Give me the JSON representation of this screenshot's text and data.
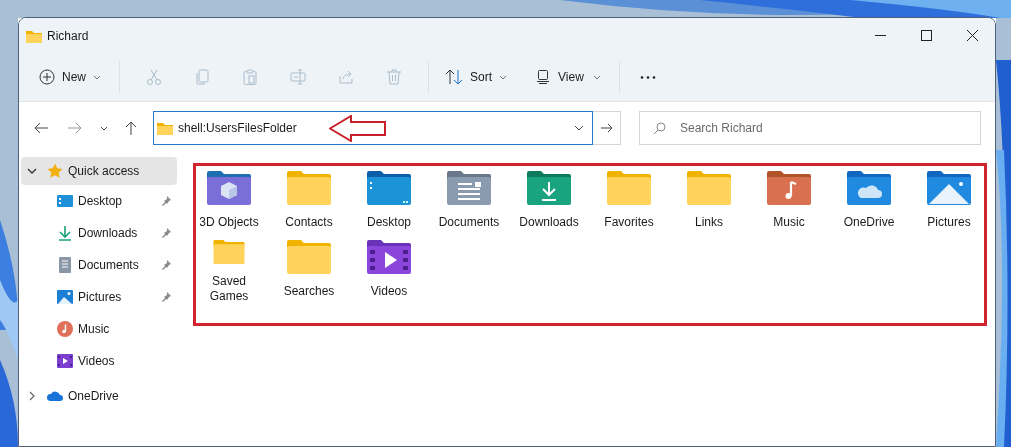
{
  "window": {
    "title": "Richard"
  },
  "toolbar": {
    "new": {
      "label": "New"
    },
    "actions": [
      {
        "kind": "cut",
        "disabled": true
      },
      {
        "kind": "copy",
        "disabled": true
      },
      {
        "kind": "paste",
        "disabled": true
      },
      {
        "kind": "rename",
        "disabled": true
      },
      {
        "kind": "share",
        "disabled": true
      },
      {
        "kind": "delete",
        "disabled": true
      }
    ],
    "sort": {
      "label": "Sort"
    },
    "view": {
      "label": "View"
    }
  },
  "address": {
    "value": "shell:UsersFilesFolder"
  },
  "search": {
    "placeholder": "Search Richard"
  },
  "sidebar": {
    "items": [
      {
        "label": "Quick access",
        "kind": "star",
        "selected": true,
        "expanded": true,
        "children": [
          {
            "label": "Desktop",
            "kind": "desktop",
            "pinned": true
          },
          {
            "label": "Downloads",
            "kind": "downloads",
            "pinned": true
          },
          {
            "label": "Documents",
            "kind": "documents",
            "pinned": true
          },
          {
            "label": "Pictures",
            "kind": "pictures",
            "pinned": true
          },
          {
            "label": "Music",
            "kind": "music",
            "pinned": false
          },
          {
            "label": "Videos",
            "kind": "videos",
            "pinned": false
          }
        ]
      },
      {
        "label": "OneDrive",
        "kind": "cloud",
        "selected": false,
        "expanded": false
      }
    ]
  },
  "folders": [
    {
      "label": "3D Objects",
      "kind": "objects3d"
    },
    {
      "label": "Contacts",
      "kind": "plain"
    },
    {
      "label": "Desktop",
      "kind": "desktop"
    },
    {
      "label": "Documents",
      "kind": "documents"
    },
    {
      "label": "Downloads",
      "kind": "downloads"
    },
    {
      "label": "Favorites",
      "kind": "plain"
    },
    {
      "label": "Links",
      "kind": "plain"
    },
    {
      "label": "Music",
      "kind": "music"
    },
    {
      "label": "OneDrive",
      "kind": "onedrive"
    },
    {
      "label": "Pictures",
      "kind": "pictures"
    },
    {
      "label": "Saved Games",
      "kind": "plain"
    },
    {
      "label": "Searches",
      "kind": "plain"
    },
    {
      "label": "Videos",
      "kind": "videos"
    }
  ]
}
